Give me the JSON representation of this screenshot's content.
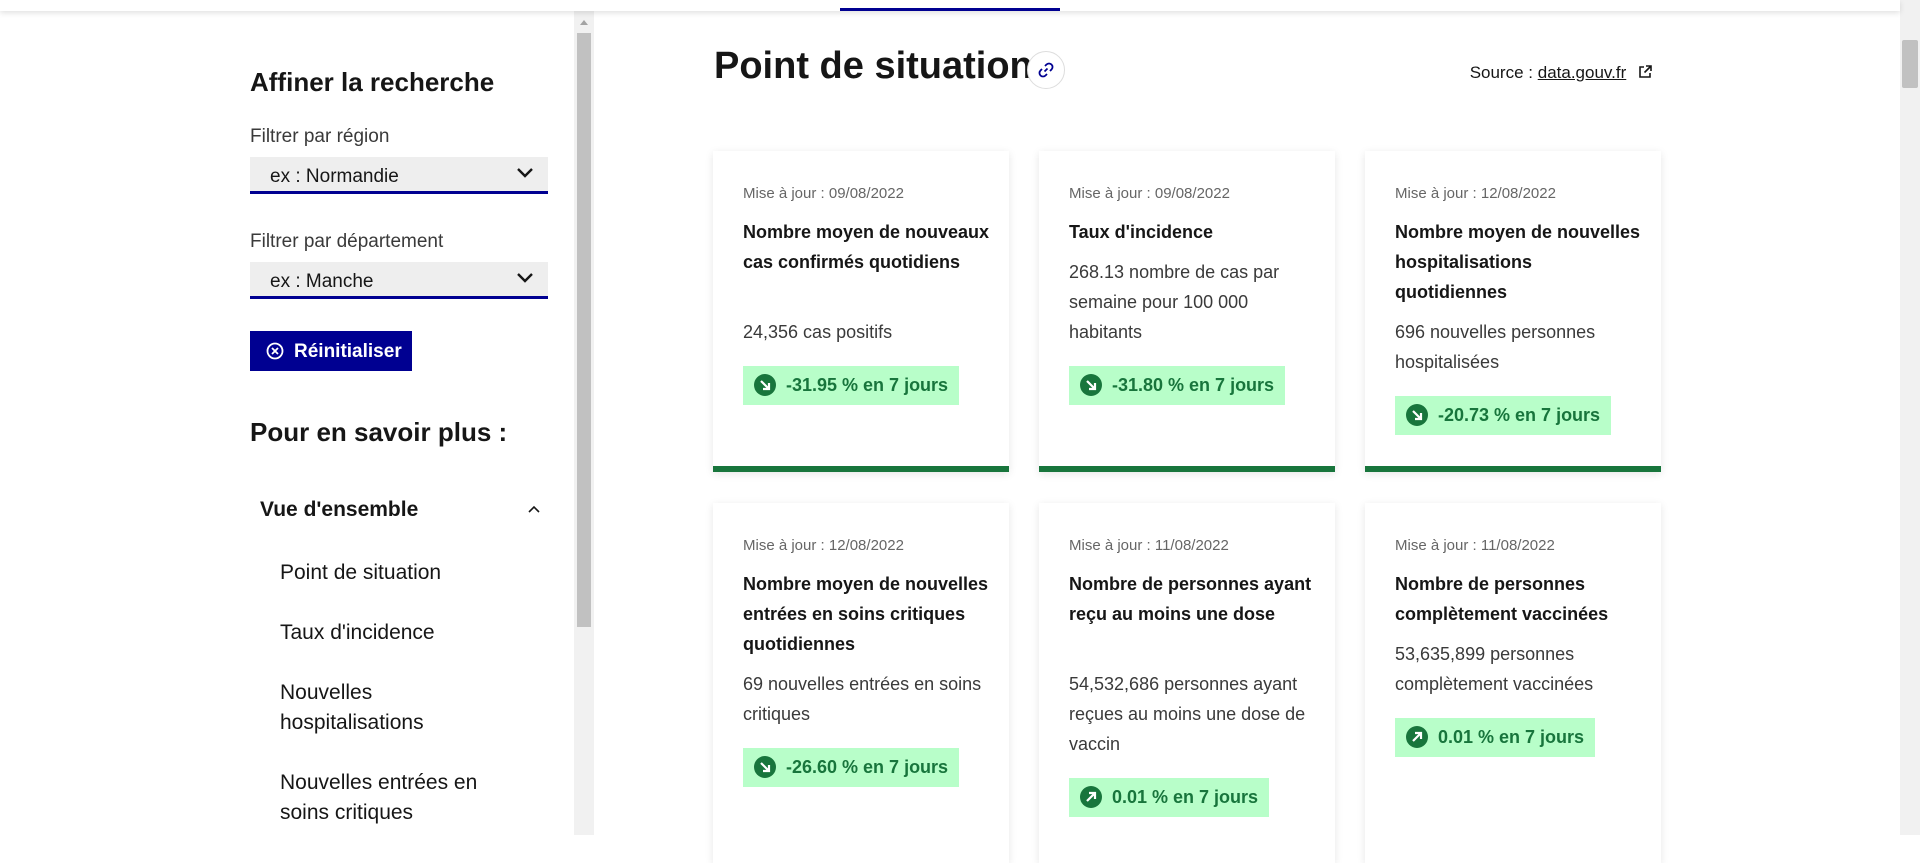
{
  "sidebar": {
    "title": "Affiner la recherche",
    "region_filter": {
      "label": "Filtrer par région",
      "value": "ex : Normandie"
    },
    "department_filter": {
      "label": "Filtrer par département",
      "value": "ex : Manche"
    },
    "reset_label": "Réinitialiser",
    "subtitle": "Pour en savoir plus :",
    "accordion": {
      "label": "Vue d'ensemble",
      "items": [
        "Point de situation",
        "Taux d'incidence",
        "Nouvelles hospitalisations",
        "Nouvelles entrées en soins critiques"
      ]
    }
  },
  "main": {
    "title": "Point de situation",
    "source_prefix": "Source :",
    "source_link": "data.gouv.fr",
    "cards": [
      {
        "date": "Mise à jour : 09/08/2022",
        "title": "Nombre moyen de nouveaux cas confirmés quotidiens",
        "value": "24,356 cas positifs",
        "trend": "-31.95 % en 7 jours",
        "direction": "down"
      },
      {
        "date": "Mise à jour : 09/08/2022",
        "title": "Taux d'incidence",
        "value": "268.13 nombre de cas par semaine pour 100 000 habitants",
        "trend": "-31.80 % en 7 jours",
        "direction": "down"
      },
      {
        "date": "Mise à jour : 12/08/2022",
        "title": "Nombre moyen de nouvelles hospitalisations quotidiennes",
        "value": "696 nouvelles personnes hospitalisées",
        "trend": "-20.73 % en 7 jours",
        "direction": "down"
      },
      {
        "date": "Mise à jour : 12/08/2022",
        "title": "Nombre moyen de nouvelles entrées en soins critiques quotidiennes",
        "value": "69 nouvelles entrées en soins critiques",
        "trend": "-26.60 % en 7 jours",
        "direction": "down"
      },
      {
        "date": "Mise à jour : 11/08/2022",
        "title": "Nombre de personnes ayant reçu au moins une dose",
        "value": "54,532,686 personnes ayant reçues au moins une dose de vaccin",
        "trend": "0.01 % en 7 jours",
        "direction": "up"
      },
      {
        "date": "Mise à jour : 11/08/2022",
        "title": "Nombre de personnes complètement vaccinées",
        "value": "53,635,899 personnes complètement vaccinées",
        "trend": "0.01 % en 7 jours",
        "direction": "up"
      }
    ]
  },
  "colors": {
    "primary": "#000091",
    "success": "#18753c",
    "success_bg": "#b8fec9"
  },
  "icons": [
    "chevron-down-icon",
    "close-circle-icon",
    "chevron-up-icon",
    "link-icon",
    "external-link-icon",
    "arrow-down-right-icon",
    "arrow-up-right-icon"
  ]
}
